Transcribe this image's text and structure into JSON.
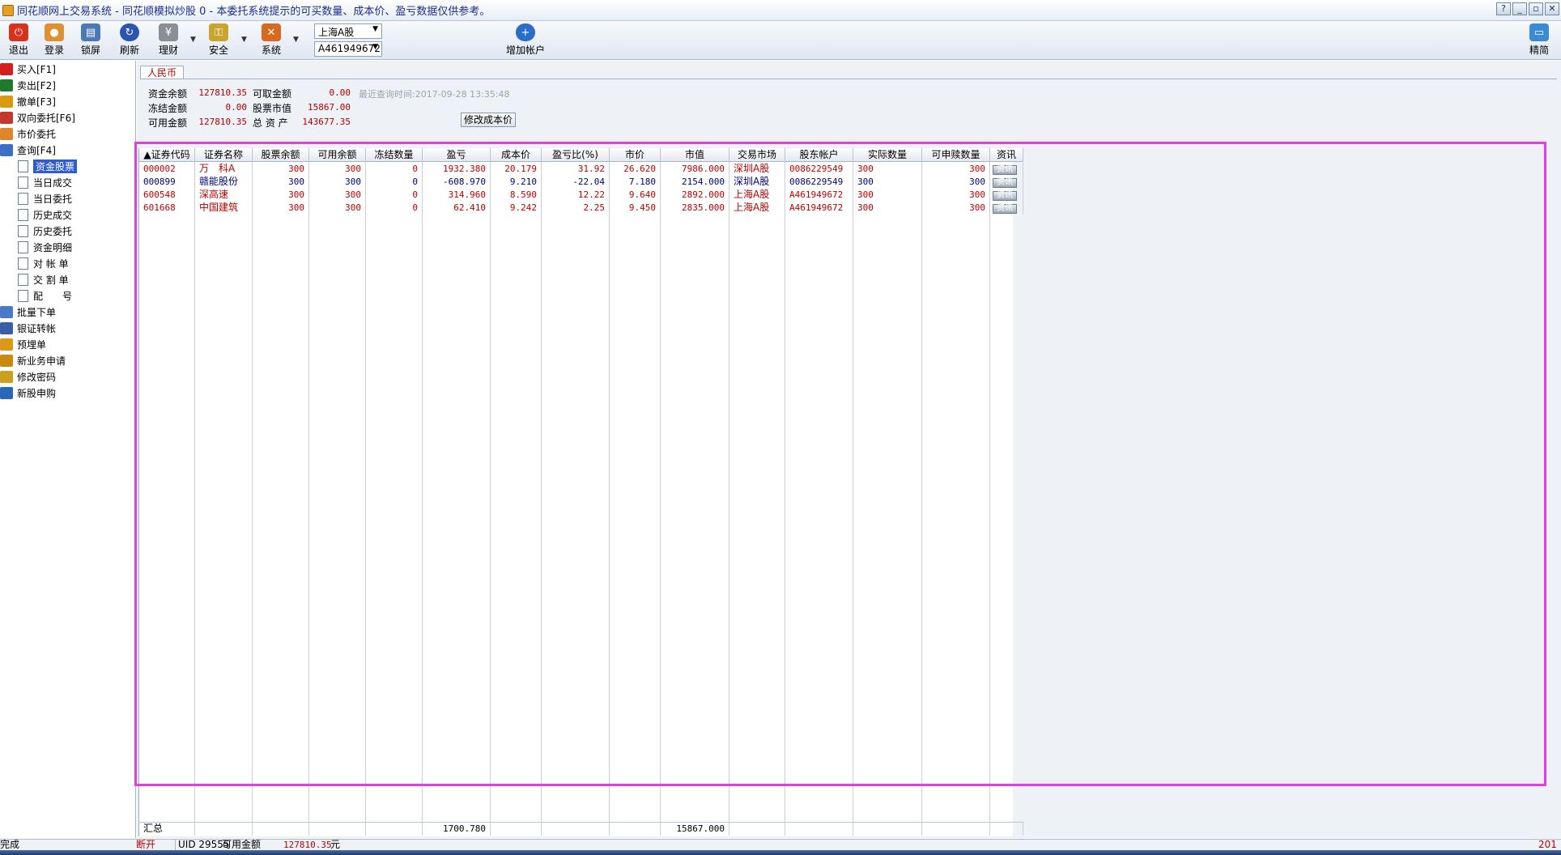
{
  "window": {
    "title": "同花顺网上交易系统 - 同花顺模拟炒股 0 - 本委托系统提示的可买数量、成本价、盈亏数据仅供参考。",
    "controls": [
      "?",
      "_",
      "▫",
      "✕"
    ]
  },
  "toolbar": {
    "exit": "退出",
    "login": "登录",
    "lock": "锁屏",
    "refresh": "刷新",
    "finance": "理财",
    "security": "安全",
    "system": "系统",
    "market_select": "上海A股",
    "account_select": "A461949672",
    "add_account": "增加帐户",
    "simple": "精简"
  },
  "sidebar": {
    "items": [
      {
        "label": "买入[F1]",
        "icon": "buy-icon",
        "color": "#d21f1f"
      },
      {
        "label": "卖出[F2]",
        "icon": "sell-icon",
        "color": "#1f7a2e"
      },
      {
        "label": "撤单[F3]",
        "icon": "cancel-order-icon",
        "color": "#d89a10"
      },
      {
        "label": "双向委托[F6]",
        "icon": "two-way-order-icon",
        "color": "#c0392b"
      },
      {
        "label": "市价委托",
        "icon": "market-order-icon",
        "color": "#e0862a"
      },
      {
        "label": "查询[F4]",
        "icon": "query-icon",
        "color": "#3b6fc4"
      }
    ],
    "query_sub": [
      "资金股票",
      "当日成交",
      "当日委托",
      "历史成交",
      "历史委托",
      "资金明细",
      "对 帐 单",
      "交 割 单",
      "配　　号"
    ],
    "items2": [
      {
        "label": "批量下单",
        "icon": "batch-order-icon",
        "color": "#4a79c9"
      },
      {
        "label": "银证转帐",
        "icon": "bank-transfer-icon",
        "color": "#3a5fa8"
      },
      {
        "label": "预埋单",
        "icon": "preset-order-icon",
        "color": "#d99a16"
      },
      {
        "label": "新业务申请",
        "icon": "new-business-icon",
        "color": "#c98a10"
      },
      {
        "label": "修改密码",
        "icon": "key-icon",
        "color": "#c9a020"
      },
      {
        "label": "新股申购",
        "icon": "ipo-subscribe-icon",
        "color": "#2a66b8"
      }
    ]
  },
  "tab": {
    "currency": "人民币"
  },
  "funds": {
    "balance_label": "资金余额",
    "balance": "127810.35",
    "withdrawable_label": "可取金额",
    "withdrawable": "0.00",
    "frozen_label": "冻结金额",
    "frozen": "0.00",
    "stock_value_label": "股票市值",
    "stock_value": "15867.00",
    "available_label": "可用金额",
    "available": "127810.35",
    "total_assets_label": "总 资 产",
    "total_assets": "143677.35",
    "last_query": "最近查询时间:2017-09-28 13:35:48",
    "modify_cost_button": "修改成本价"
  },
  "grid": {
    "columns": [
      "▲证券代码",
      "证券名称",
      "股票余额",
      "可用余额",
      "冻结数量",
      "盈亏",
      "成本价",
      "盈亏比(%)",
      "市价",
      "市值",
      "交易市场",
      "股东帐户",
      "实际数量",
      "可申赎数量",
      "资讯"
    ],
    "rows": [
      {
        "code": "000002",
        "name": "万　科A",
        "balance": "300",
        "available": "300",
        "frozen": "0",
        "pnl": "1932.380",
        "cost": "20.179",
        "pnl_pct": "31.92",
        "price": "26.620",
        "value": "7986.000",
        "market": "深圳A股",
        "holder": "0086229549",
        "actual": "300",
        "redeemable": "300",
        "info": "资讯"
      },
      {
        "code": "000899",
        "name": "赣能股份",
        "balance": "300",
        "available": "300",
        "frozen": "0",
        "pnl": "-608.970",
        "cost": "9.210",
        "pnl_pct": "-22.04",
        "price": "7.180",
        "value": "2154.000",
        "market": "深圳A股",
        "holder": "0086229549",
        "actual": "300",
        "redeemable": "300",
        "info": "资讯"
      },
      {
        "code": "600548",
        "name": "深高速",
        "balance": "300",
        "available": "300",
        "frozen": "0",
        "pnl": "314.960",
        "cost": "8.590",
        "pnl_pct": "12.22",
        "price": "9.640",
        "value": "2892.000",
        "market": "上海A股",
        "holder": "A461949672",
        "actual": "300",
        "redeemable": "300",
        "info": "资讯"
      },
      {
        "code": "601668",
        "name": "中国建筑",
        "balance": "300",
        "available": "300",
        "frozen": "0",
        "pnl": "62.410",
        "cost": "9.242",
        "pnl_pct": "2.25",
        "price": "9.450",
        "value": "2835.000",
        "market": "上海A股",
        "holder": "A461949672",
        "actual": "300",
        "redeemable": "300",
        "info": "资讯"
      }
    ],
    "total_label": "汇总",
    "total_pnl": "1700.780",
    "total_value": "15867.000"
  },
  "status": {
    "done": "完成",
    "disconnect": "断开",
    "uid": "UID 29555",
    "available_label": "可用金额",
    "available": "127810.35",
    "unit": "元",
    "year": "201"
  }
}
